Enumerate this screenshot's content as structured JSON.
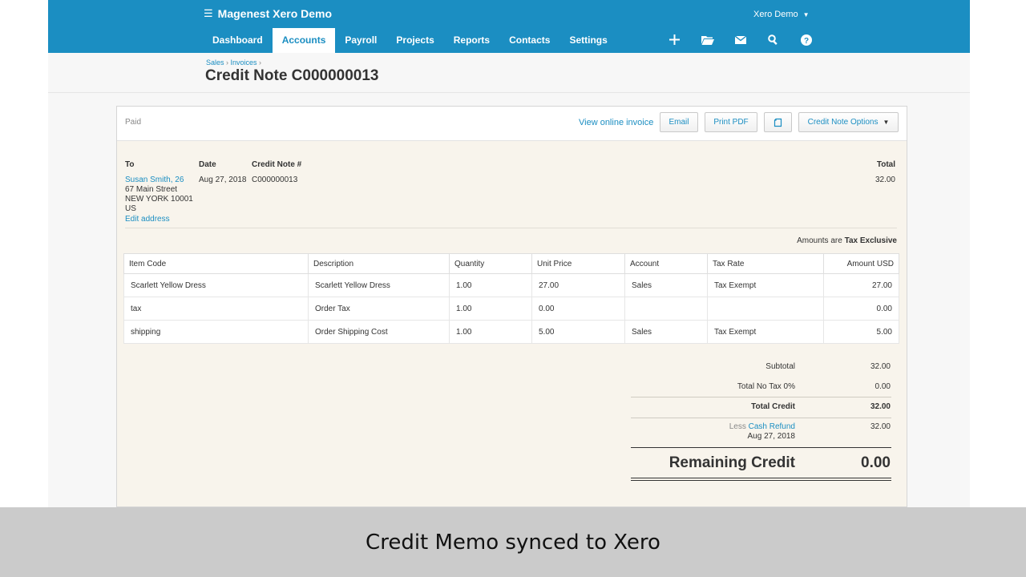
{
  "header": {
    "brand": "Magenest Xero Demo",
    "org_switch": "Xero Demo",
    "nav": [
      "Dashboard",
      "Accounts",
      "Payroll",
      "Projects",
      "Reports",
      "Contacts",
      "Settings"
    ],
    "active_tab": "Accounts",
    "tools": [
      "plus-icon",
      "folder-icon",
      "mail-icon",
      "search-icon",
      "help-icon"
    ]
  },
  "breadcrumb": [
    "Sales",
    "Invoices"
  ],
  "page_title": "Credit Note C000000013",
  "toolbar": {
    "status": "Paid",
    "view_online": "View online invoice",
    "email": "Email",
    "print_pdf": "Print PDF",
    "options": "Credit Note Options"
  },
  "details": {
    "to_label": "To",
    "contact_name": "Susan Smith, 26",
    "address_lines": [
      "67 Main Street",
      "NEW YORK 10001",
      "US"
    ],
    "edit_address": "Edit address",
    "date_label": "Date",
    "date": "Aug 27, 2018",
    "number_label": "Credit Note #",
    "number": "C000000013",
    "total_label": "Total",
    "total": "32.00"
  },
  "amounts_note": {
    "prefix": "Amounts are",
    "mode": "Tax Exclusive"
  },
  "items": {
    "columns": [
      "Item Code",
      "Description",
      "Quantity",
      "Unit Price",
      "Account",
      "Tax Rate",
      "Amount USD"
    ],
    "rows": [
      [
        "Scarlett Yellow Dress",
        "Scarlett Yellow Dress",
        "1.00",
        "27.00",
        "Sales",
        "Tax Exempt",
        "27.00"
      ],
      [
        "tax",
        "Order Tax",
        "1.00",
        "0.00",
        "",
        "",
        "0.00"
      ],
      [
        "shipping",
        "Order Shipping Cost",
        "1.00",
        "5.00",
        "Sales",
        "Tax Exempt",
        "5.00"
      ]
    ]
  },
  "totals": {
    "subtotal_label": "Subtotal",
    "subtotal": "32.00",
    "tax_label": "Total No Tax 0%",
    "tax": "0.00",
    "total_credit_label": "Total Credit",
    "total_credit": "32.00",
    "less_label": "Less",
    "refund_label": "Cash Refund",
    "refund_date": "Aug 27, 2018",
    "refund": "32.00",
    "remaining_label": "Remaining Credit",
    "remaining": "0.00"
  },
  "caption": "Credit Memo synced to Xero"
}
